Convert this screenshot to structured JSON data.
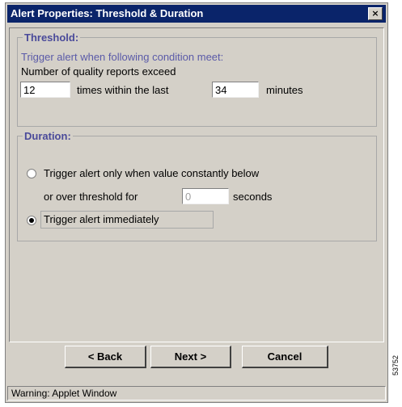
{
  "window": {
    "title": "Alert Properties: Threshold & Duration",
    "close_glyph": "×"
  },
  "threshold": {
    "legend": "Threshold:",
    "description": "Trigger alert when following condition meet:",
    "line1": "Number of quality reports exceed",
    "count_value": "12",
    "middle_text": "times within the last",
    "minutes_value": "34",
    "suffix": "minutes"
  },
  "duration": {
    "legend": "Duration:",
    "option1_line1": "Trigger alert only when value constantly below",
    "option1_line2": "or over threshold for",
    "seconds_value": "0",
    "seconds_label": "seconds",
    "option2_label": "Trigger alert immediately",
    "selected_option": 2
  },
  "buttons": {
    "back": "< Back",
    "next": "Next >",
    "cancel": "Cancel"
  },
  "status": {
    "text": "Warning: Applet Window"
  },
  "side_label": "53752"
}
